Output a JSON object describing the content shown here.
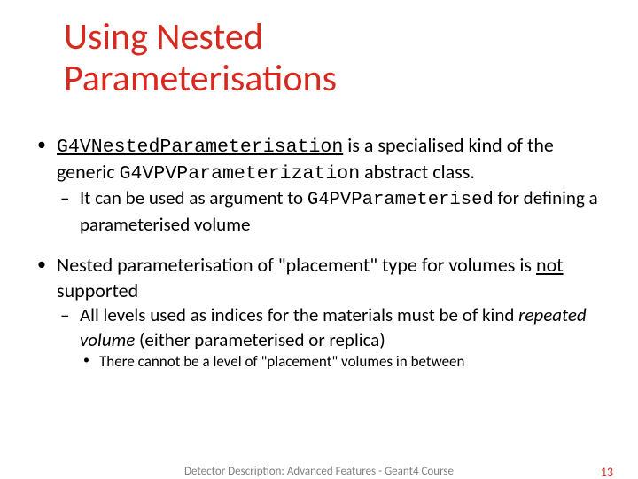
{
  "title_line1": "Using Nested",
  "title_line2": "Parameterisations",
  "bullet1": {
    "code1": "G4VNestedParameterisation",
    "text1": " is a specialised kind of the generic ",
    "code2": "G4VPVParameterization",
    "text2": " abstract class.",
    "sub1_text1": "It can be used as argument to ",
    "sub1_code": "G4PVParameterised",
    "sub1_text2": " for defining a parameterised volume"
  },
  "bullet2": {
    "text1": "Nested parameterisation of \"placement\" type for volumes is ",
    "not": "not",
    "text2": " supported",
    "sub1_text1": "All levels used as indices for the materials must be of kind ",
    "sub1_italic": "repeated volume",
    "sub1_text2": " (either parameterised or replica)",
    "subsub1": "There cannot be a level of \"placement\" volumes in between"
  },
  "footer_text": "Detector Description: Advanced Features - Geant4 Course",
  "page_number": "13"
}
